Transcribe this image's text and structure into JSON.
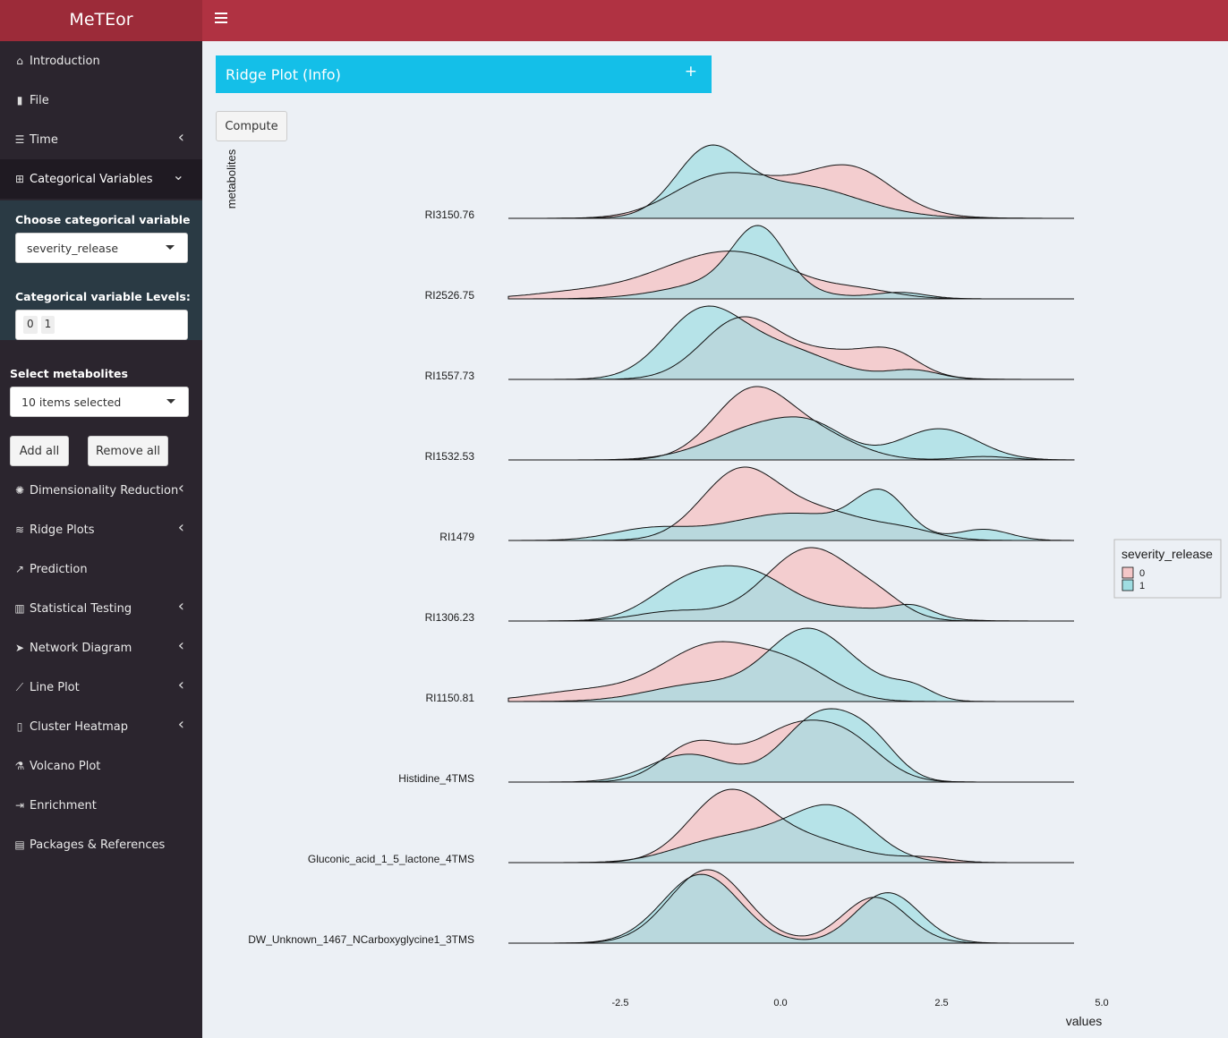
{
  "app": {
    "title": "MeTEor"
  },
  "sidebar": {
    "items": [
      {
        "label": "Introduction",
        "icon": "home-icon",
        "glyph": "⌂",
        "chevron": false
      },
      {
        "label": "File",
        "icon": "file-icon",
        "glyph": "▮",
        "chevron": false
      },
      {
        "label": "Time",
        "icon": "sliders-icon",
        "glyph": "☰",
        "chevron": true
      },
      {
        "label": "Categorical Variables",
        "icon": "table-icon",
        "glyph": "⊞",
        "chevron": true,
        "expanded": true
      },
      {
        "label": "Dimensionality Reduction",
        "icon": "dharma-icon",
        "glyph": "✺",
        "chevron": true
      },
      {
        "label": "Ridge Plots",
        "icon": "water-icon",
        "glyph": "≋",
        "chevron": true
      },
      {
        "label": "Prediction",
        "icon": "chart-line-up-icon",
        "glyph": "↗",
        "chevron": false
      },
      {
        "label": "Statistical Testing",
        "icon": "bar-chart-icon",
        "glyph": "▥",
        "chevron": true
      },
      {
        "label": "Network Diagram",
        "icon": "send-icon",
        "glyph": "➤",
        "chevron": true
      },
      {
        "label": "Line Plot",
        "icon": "line-chart-icon",
        "glyph": "⟋",
        "chevron": true
      },
      {
        "label": "Cluster Heatmap",
        "icon": "thermometer-icon",
        "glyph": "▯",
        "chevron": true
      },
      {
        "label": "Volcano Plot",
        "icon": "flask-icon",
        "glyph": "⚗",
        "chevron": false
      },
      {
        "label": "Enrichment",
        "icon": "file-export-icon",
        "glyph": "⇥",
        "chevron": false
      },
      {
        "label": "Packages & References",
        "icon": "calendar-icon",
        "glyph": "▤",
        "chevron": false
      }
    ],
    "categorical": {
      "choose_label": "Choose categorical variable",
      "selected": "severity_release",
      "levels_label": "Categorical variable Levels:",
      "levels": [
        "0",
        "1"
      ]
    },
    "metabolites": {
      "label": "Select metabolites",
      "selected": "10 items selected",
      "add_all": "Add all",
      "remove_all": "Remove all"
    }
  },
  "main": {
    "info_box": {
      "title": "Ridge Plot (Info)",
      "toggle": "+"
    },
    "compute_label": "Compute"
  },
  "chart_data": {
    "type": "ridgeline",
    "xlabel": "values",
    "ylabel": "metabolites",
    "xticks": [
      "-2.5",
      "0.0",
      "2.5",
      "5.0"
    ],
    "xlim": [
      -4.2,
      4.6
    ],
    "legend": {
      "title": "severity_release",
      "entries": [
        "0",
        "1"
      ],
      "position": "right"
    },
    "colors": {
      "0": "#f4c7c8",
      "1": "#9fdde2",
      "overlap": "#a8c5c9"
    },
    "series": [
      {
        "name": "RI3150.76",
        "g0": [
          [
            -1.0,
            0.7,
            0.55
          ],
          [
            0.5,
            1.0,
            0.5
          ],
          [
            1.2,
            0.6,
            0.45
          ]
        ],
        "g1": [
          [
            -1.1,
            0.5,
            0.95
          ],
          [
            0.2,
            1.0,
            0.55
          ]
        ]
      },
      {
        "name": "RI2526.75",
        "g0": [
          [
            -3.0,
            0.8,
            0.12
          ],
          [
            -1.3,
            0.8,
            0.5
          ],
          [
            -0.3,
            0.7,
            0.45
          ],
          [
            1.2,
            0.6,
            0.15
          ]
        ],
        "g1": [
          [
            -0.3,
            0.4,
            0.9
          ],
          [
            -0.7,
            0.9,
            0.3
          ],
          [
            1.9,
            0.4,
            0.1
          ]
        ]
      },
      {
        "name": "RI1557.73",
        "g0": [
          [
            -0.6,
            0.6,
            0.65
          ],
          [
            0.9,
            0.8,
            0.3
          ],
          [
            1.8,
            0.4,
            0.18
          ]
        ],
        "g1": [
          [
            -1.2,
            0.6,
            0.7
          ],
          [
            0.0,
            0.8,
            0.35
          ],
          [
            2.1,
            0.4,
            0.1
          ]
        ]
      },
      {
        "name": "RI1532.53",
        "g0": [
          [
            -0.4,
            0.6,
            1.0
          ],
          [
            0.7,
            0.6,
            0.3
          ],
          [
            3.2,
            0.4,
            0.05
          ]
        ],
        "g1": [
          [
            -0.2,
            0.8,
            0.5
          ],
          [
            0.6,
            0.5,
            0.25
          ],
          [
            2.5,
            0.6,
            0.45
          ]
        ]
      },
      {
        "name": "RI1479",
        "g0": [
          [
            -0.6,
            0.6,
            0.75
          ],
          [
            0.7,
            0.7,
            0.3
          ],
          [
            2.0,
            0.5,
            0.1
          ]
        ],
        "g1": [
          [
            -2.0,
            0.6,
            0.12
          ],
          [
            0.2,
            1.0,
            0.3
          ],
          [
            1.6,
            0.4,
            0.45
          ],
          [
            3.2,
            0.4,
            0.12
          ]
        ]
      },
      {
        "name": "RI1306.23",
        "g0": [
          [
            0.5,
            0.7,
            0.9
          ],
          [
            -1.6,
            0.6,
            0.12
          ],
          [
            1.6,
            0.4,
            0.15
          ]
        ],
        "g1": [
          [
            -1.4,
            0.6,
            0.45
          ],
          [
            -0.4,
            0.6,
            0.5
          ],
          [
            1.2,
            0.8,
            0.15
          ],
          [
            2.1,
            0.3,
            0.12
          ]
        ]
      },
      {
        "name": "RI1150.81",
        "g0": [
          [
            -3.0,
            0.8,
            0.12
          ],
          [
            -1.0,
            0.8,
            0.65
          ],
          [
            0.3,
            0.6,
            0.3
          ]
        ],
        "g1": [
          [
            -1.2,
            0.8,
            0.2
          ],
          [
            0.4,
            0.6,
            0.75
          ],
          [
            1.3,
            0.6,
            0.2
          ],
          [
            2.1,
            0.3,
            0.12
          ]
        ]
      },
      {
        "name": "Histidine_4TMS",
        "g0": [
          [
            -1.3,
            0.5,
            0.4
          ],
          [
            0.3,
            0.7,
            0.6
          ],
          [
            1.2,
            0.5,
            0.25
          ]
        ],
        "g1": [
          [
            -1.4,
            0.6,
            0.3
          ],
          [
            0.7,
            0.6,
            0.75
          ],
          [
            1.5,
            0.4,
            0.25
          ]
        ]
      },
      {
        "name": "Gluconic_acid_1_5_lactone_4TMS",
        "g0": [
          [
            -0.8,
            0.6,
            0.85
          ],
          [
            0.4,
            0.8,
            0.3
          ],
          [
            2.3,
            0.4,
            0.06
          ]
        ],
        "g1": [
          [
            -0.2,
            0.8,
            0.35
          ],
          [
            0.9,
            0.6,
            0.6
          ],
          [
            -1.3,
            0.6,
            0.12
          ]
        ]
      },
      {
        "name": "DW_Unknown_1467_NCarboxyglycine1_3TMS",
        "g0": [
          [
            -1.1,
            0.6,
            0.8
          ],
          [
            1.5,
            0.5,
            0.5
          ]
        ],
        "g1": [
          [
            -1.2,
            0.6,
            0.75
          ],
          [
            1.7,
            0.5,
            0.55
          ]
        ]
      }
    ]
  }
}
